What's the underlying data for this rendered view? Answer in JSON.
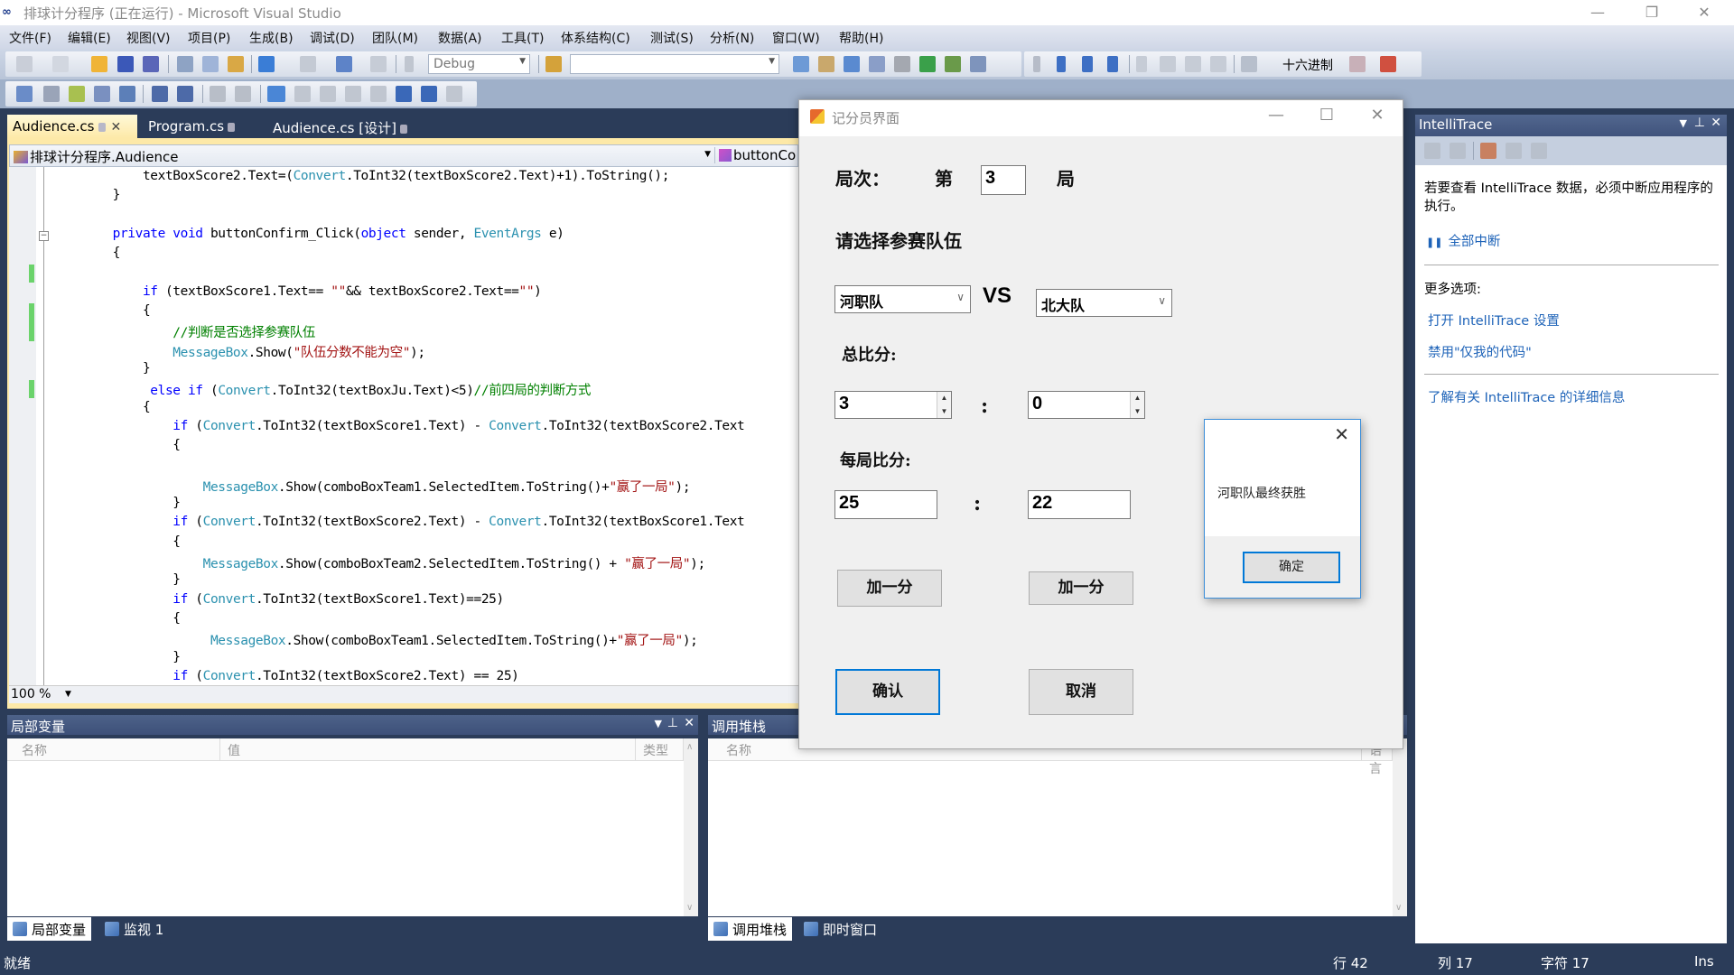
{
  "window": {
    "title": "排球计分程序 (正在运行) - Microsoft Visual Studio",
    "controls": {
      "minimize": "—",
      "restore": "❐",
      "close": "✕"
    }
  },
  "menu": [
    "文件(F)",
    "编辑(E)",
    "视图(V)",
    "项目(P)",
    "生成(B)",
    "调试(D)",
    "团队(M)",
    "数据(A)",
    "工具(T)",
    "体系结构(C)",
    "测试(S)",
    "分析(N)",
    "窗口(W)",
    "帮助(H)"
  ],
  "toolbar": {
    "config_combo": "Debug",
    "search_combo": "",
    "hex_label": "十六进制"
  },
  "doc_tabs": [
    {
      "label": "Audience.cs",
      "active": true
    },
    {
      "label": "Program.cs",
      "active": false
    },
    {
      "label": "Audience.cs [设计]",
      "active": false
    }
  ],
  "editor": {
    "nav_class": "排球计分程序.Audience",
    "nav_member": "buttonCo",
    "zoom": "100 %",
    "lines": [
      [
        [
          "            textBoxScore2.Text=(",
          ""
        ],
        [
          "Convert",
          "ty"
        ],
        [
          ".ToInt32(textBoxScore2.Text)+1).ToString();",
          ""
        ]
      ],
      [
        [
          "        }",
          ""
        ]
      ],
      [
        [
          "",
          ""
        ]
      ],
      [
        [
          "        ",
          ""
        ],
        [
          "private",
          "kw"
        ],
        [
          " ",
          ""
        ],
        [
          "void",
          "kw"
        ],
        [
          " buttonConfirm_Click(",
          ""
        ],
        [
          "object",
          "kw"
        ],
        [
          " sender, ",
          ""
        ],
        [
          "EventArgs",
          "ty"
        ],
        [
          " e)",
          ""
        ]
      ],
      [
        [
          "        {",
          ""
        ]
      ],
      [
        [
          "",
          ""
        ]
      ],
      [
        [
          "            ",
          ""
        ],
        [
          "if",
          "kw"
        ],
        [
          " (textBoxScore1.Text== ",
          ""
        ],
        [
          "\"\"",
          "str"
        ],
        [
          "&& textBoxScore2.Text==",
          ""
        ],
        [
          "\"\"",
          "str"
        ],
        [
          ")",
          ""
        ]
      ],
      [
        [
          "            {",
          ""
        ]
      ],
      [
        [
          "                ",
          ""
        ],
        [
          "//判断是否选择参赛队伍",
          "cm"
        ]
      ],
      [
        [
          "                ",
          ""
        ],
        [
          "MessageBox",
          "ty"
        ],
        [
          ".Show(",
          ""
        ],
        [
          "\"队伍分数不能为空\"",
          "str"
        ],
        [
          ");",
          ""
        ]
      ],
      [
        [
          "            }",
          ""
        ]
      ],
      [
        [
          "             ",
          ""
        ],
        [
          "else",
          "kw"
        ],
        [
          " ",
          ""
        ],
        [
          "if",
          "kw"
        ],
        [
          " (",
          ""
        ],
        [
          "Convert",
          "ty"
        ],
        [
          ".ToInt32(textBoxJu.Text)<5)",
          ""
        ],
        [
          "//前四局的判断方式",
          "cm"
        ]
      ],
      [
        [
          "            {",
          ""
        ]
      ],
      [
        [
          "                ",
          ""
        ],
        [
          "if",
          "kw"
        ],
        [
          " (",
          ""
        ],
        [
          "Convert",
          "ty"
        ],
        [
          ".ToInt32(textBoxScore1.Text) - ",
          ""
        ],
        [
          "Convert",
          "ty"
        ],
        [
          ".ToInt32(textBoxScore2.Text",
          ""
        ]
      ],
      [
        [
          "                {",
          ""
        ]
      ],
      [
        [
          "",
          ""
        ]
      ],
      [
        [
          "                    ",
          ""
        ],
        [
          "MessageBox",
          "ty"
        ],
        [
          ".Show(comboBoxTeam1.SelectedItem.ToString()+",
          ""
        ],
        [
          "\"赢了一局\"",
          "str"
        ],
        [
          ");",
          ""
        ]
      ],
      [
        [
          "                }",
          ""
        ]
      ],
      [
        [
          "                ",
          ""
        ],
        [
          "if",
          "kw"
        ],
        [
          " (",
          ""
        ],
        [
          "Convert",
          "ty"
        ],
        [
          ".ToInt32(textBoxScore2.Text) - ",
          ""
        ],
        [
          "Convert",
          "ty"
        ],
        [
          ".ToInt32(textBoxScore1.Text",
          ""
        ]
      ],
      [
        [
          "                {",
          ""
        ]
      ],
      [
        [
          "                    ",
          ""
        ],
        [
          "MessageBox",
          "ty"
        ],
        [
          ".Show(comboBoxTeam2.SelectedItem.ToString() + ",
          ""
        ],
        [
          "\"赢了一局\"",
          "str"
        ],
        [
          ");",
          ""
        ]
      ],
      [
        [
          "                }",
          ""
        ]
      ],
      [
        [
          "                ",
          ""
        ],
        [
          "if",
          "kw"
        ],
        [
          " (",
          ""
        ],
        [
          "Convert",
          "ty"
        ],
        [
          ".ToInt32(textBoxScore1.Text)==25)",
          ""
        ]
      ],
      [
        [
          "                {",
          ""
        ]
      ],
      [
        [
          "                     ",
          ""
        ],
        [
          "MessageBox",
          "ty"
        ],
        [
          ".Show(comboBoxTeam1.SelectedItem.ToString()+",
          ""
        ],
        [
          "\"赢了一局\"",
          "str"
        ],
        [
          ");",
          ""
        ]
      ],
      [
        [
          "                }",
          ""
        ]
      ],
      [
        [
          "                ",
          ""
        ],
        [
          "if",
          "kw"
        ],
        [
          " (",
          ""
        ],
        [
          "Convert",
          "ty"
        ],
        [
          ".ToInt32(textBoxScore2.Text) == 25)",
          ""
        ]
      ]
    ]
  },
  "locals_pane": {
    "title": "局部变量",
    "columns": [
      "名称",
      "值",
      "类型"
    ],
    "tabs": [
      "局部变量",
      "监视 1"
    ]
  },
  "callstack_pane": {
    "title": "调用堆栈",
    "columns": [
      "名称",
      "语言"
    ],
    "tabs": [
      "调用堆栈",
      "即时窗口"
    ]
  },
  "intellitrace": {
    "title": "IntelliTrace",
    "message": "若要查看 IntelliTrace 数据，必须中断应用程序的执行。",
    "break_all": "全部中断",
    "more_options": "更多选项:",
    "links": [
      "打开 IntelliTrace 设置",
      "禁用\"仅我的代码\""
    ],
    "learn_more": "了解有关 IntelliTrace 的详细信息"
  },
  "status": {
    "text": "就绪",
    "line": "行 42",
    "col": "列 17",
    "char": "字符 17",
    "mode": "Ins"
  },
  "scorer_dialog": {
    "title": "记分员界面",
    "round_label": "局次：",
    "round_prefix": "第",
    "round_value": "3",
    "round_suffix": "局",
    "select_teams_label": "请选择参赛队伍",
    "team1": "河职队",
    "vs": "VS",
    "team2": "北大队",
    "total_label": "总比分:",
    "total_score1": "3",
    "total_score2": "0",
    "colon": ":",
    "set_label": "每局比分:",
    "set_score1": "25",
    "set_score2": "22",
    "add_point1": "加一分",
    "add_point2": "加一分",
    "confirm": "确认",
    "cancel": "取消"
  },
  "message_box": {
    "text": "河职队最终获胜",
    "ok": "确定",
    "close": "✕"
  }
}
